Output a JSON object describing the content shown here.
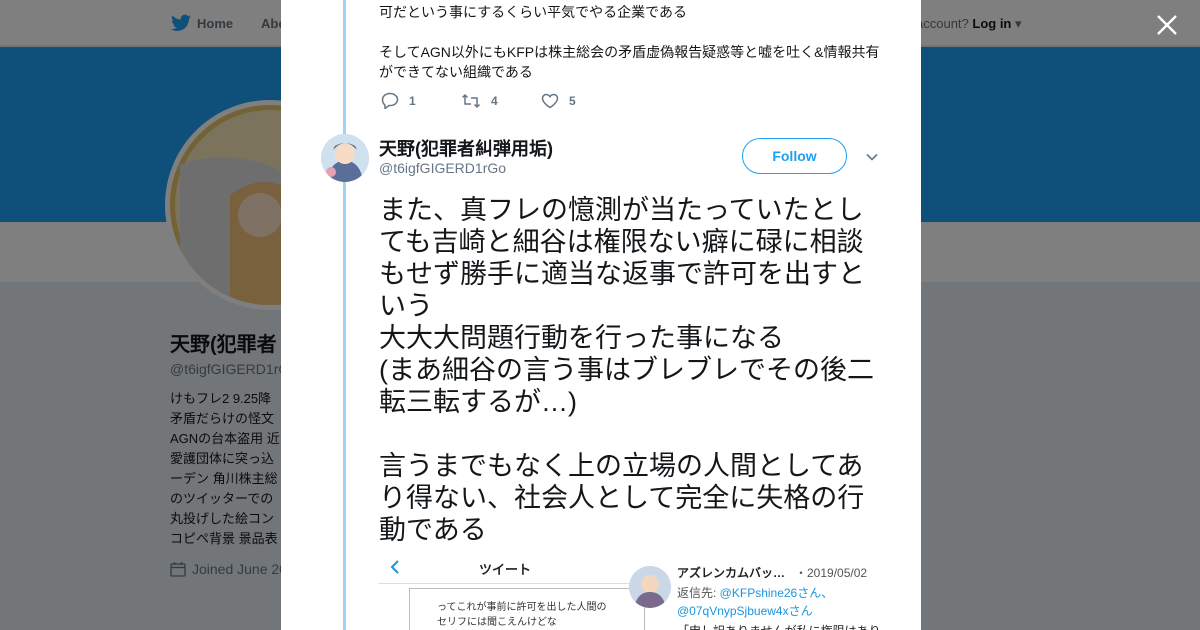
{
  "nav": {
    "home_label": "Home",
    "about_label": "Abo",
    "account_prompt": "account?",
    "login_label": "Log in"
  },
  "profile": {
    "name": "天野(犯罪者",
    "handle": "@t6igfGIGERD1rG",
    "bio": "けもフレ2 9.25降\n矛盾だらけの怪文\nAGNの台本盗用 近\n愛護団体に突っ込\nーデン 角川株主総\nのツイッターでの\n丸投げした絵コン\nコピペ背景 景品表",
    "joined": "Joined June 20"
  },
  "previous_tweet": {
    "text": "可だという事にするくらい平気でやる企業である\n\nそしてAGN以外にもKFPは株主総会の矛盾虚偽報告疑惑等と嘘を吐く&情報共有ができてない組織である",
    "replies": "1",
    "retweets": "4",
    "likes": "5"
  },
  "tweet": {
    "author_name": "天野(犯罪者糾弾用垢)",
    "author_handle": "@t6igfGIGERD1rGo",
    "follow_label": "Follow",
    "text": "また、真フレの憶測が当たっていたとしても吉崎と細谷は権限ない癖に碌に相談もせず勝手に適当な返事で許可を出すという\n大大大問題行動を行った事になる\n(まあ細谷の言う事はブレブレでその後二転三転するが…)\n\n言うまでもなく上の立場の人間としてあり得ない、社会人として完全に失格の行動である"
  },
  "embedded_image": {
    "header_title": "ツイート",
    "quote_text": "ってこれが事前に許可を出した人間の\nセリフには聞こえんけどな",
    "account_name": "アズレンカムバッ…",
    "date": "・2019/05/02",
    "reply_prefix": "返信先: ",
    "reply_handle_1": "@KFPshine26さん、",
    "reply_handle_2": "@07qVnypSjbuew4xさん",
    "snippet": "「申し訳ありませんが私に権限はあり"
  },
  "colors": {
    "brand_blue": "#1da1f2",
    "thread_line": "#9fd4f7",
    "muted": "#657786"
  }
}
